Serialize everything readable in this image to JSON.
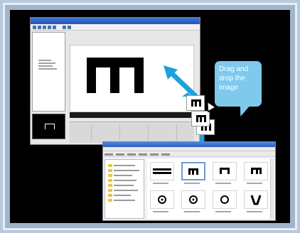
{
  "callout": {
    "line1": "Drag and",
    "line2": "drop the",
    "line3": "image"
  },
  "colors": {
    "arrow": "#1ea1d8",
    "callout_bg": "#7fc9ec",
    "stage_bg": "#000000"
  },
  "icons": [
    "pattern-icon",
    "cursor-icon",
    "folder-icon",
    "circle-icon",
    "bracket-icon"
  ]
}
